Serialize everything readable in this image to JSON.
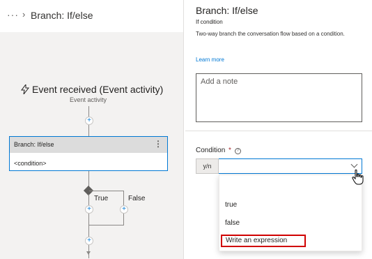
{
  "breadcrumb": {
    "ellipsis": "···",
    "separator": "›",
    "title": "Branch: If/else"
  },
  "canvas": {
    "event": {
      "title": "Event received (Event activity)",
      "subtitle": "Event activity"
    },
    "node": {
      "title": "Branch: If/else",
      "more": "⋮",
      "body": "<condition>"
    },
    "branches": {
      "true_label": "True",
      "false_label": "False"
    },
    "add_symbol": "+"
  },
  "panel": {
    "title": "Branch: If/else",
    "subtitle": "If condition",
    "description": "Two-way branch the conversation flow based on a condition.",
    "learn_more": "Learn more",
    "note_placeholder": "Add a note",
    "condition": {
      "label": "Condition",
      "required_mark": "*",
      "help_glyph": "?",
      "type_badge": "y/n",
      "value": "",
      "options": [
        "true",
        "false",
        "Write an expression"
      ]
    }
  },
  "colors": {
    "accent": "#0078d4",
    "highlight_box": "#d00000",
    "canvas_bg": "#f3f2f1"
  }
}
